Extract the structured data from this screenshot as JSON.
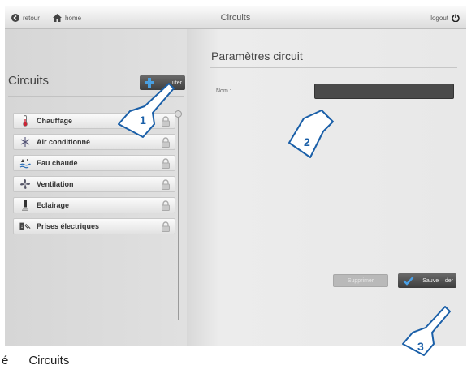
{
  "topbar": {
    "retour_label": "retour",
    "home_label": "home",
    "title": "Circuits",
    "logout_label": "logout"
  },
  "left_panel": {
    "title": "Circuits",
    "add_button_label": "uter",
    "items": [
      {
        "label": "Chauffage",
        "icon": "thermometer-icon"
      },
      {
        "label": "Air conditionné",
        "icon": "snowflake-icon"
      },
      {
        "label": "Eau chaude",
        "icon": "water-heater-icon"
      },
      {
        "label": "Ventilation",
        "icon": "fan-icon"
      },
      {
        "label": "Eclairage",
        "icon": "lamp-icon"
      },
      {
        "label": "Prises électriques",
        "icon": "plug-icon"
      }
    ]
  },
  "right_panel": {
    "title": "Paramètres circuit",
    "nom_label": "Nom :",
    "nom_value": "",
    "delete_label": "Supprimer",
    "save_label": "Sauve    der"
  },
  "callouts": [
    "1",
    "2",
    "3"
  ],
  "caption": "é      Circuits",
  "colors": {
    "accent_blue": "#1f6fc0",
    "callout_border": "#1a5fa8",
    "dark_button": "#4a4a4a"
  }
}
